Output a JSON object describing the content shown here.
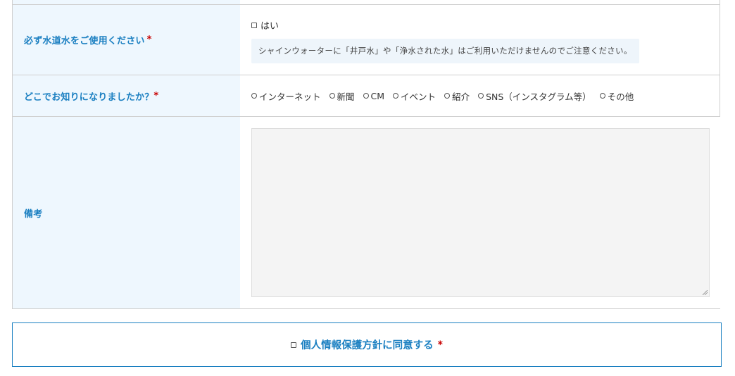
{
  "form": {
    "water_row": {
      "label": "必ず水道水をご使用ください",
      "required_mark": "*",
      "checkbox_label": "はい",
      "notice": "シャインウォーターに「井戸水」や「浄水された水」はご利用いただけませんのでご注意ください。"
    },
    "where_row": {
      "label": "どこでお知りになりましたか？",
      "required_mark": "*",
      "options": [
        "インターネット",
        "新聞",
        "CM",
        "イベント",
        "紹介",
        "SNS（インスタグラム等）",
        "その他"
      ]
    },
    "notes_row": {
      "label": "備考"
    }
  },
  "privacy": {
    "label": "個人情報保護方針に同意する",
    "required_mark": "*"
  },
  "colors": {
    "accent": "#1a7fc1",
    "header_bg": "#eef7fe",
    "required": "#c80000",
    "notice_bg": "#eef5fb",
    "textarea_bg": "#f4f4f4"
  }
}
